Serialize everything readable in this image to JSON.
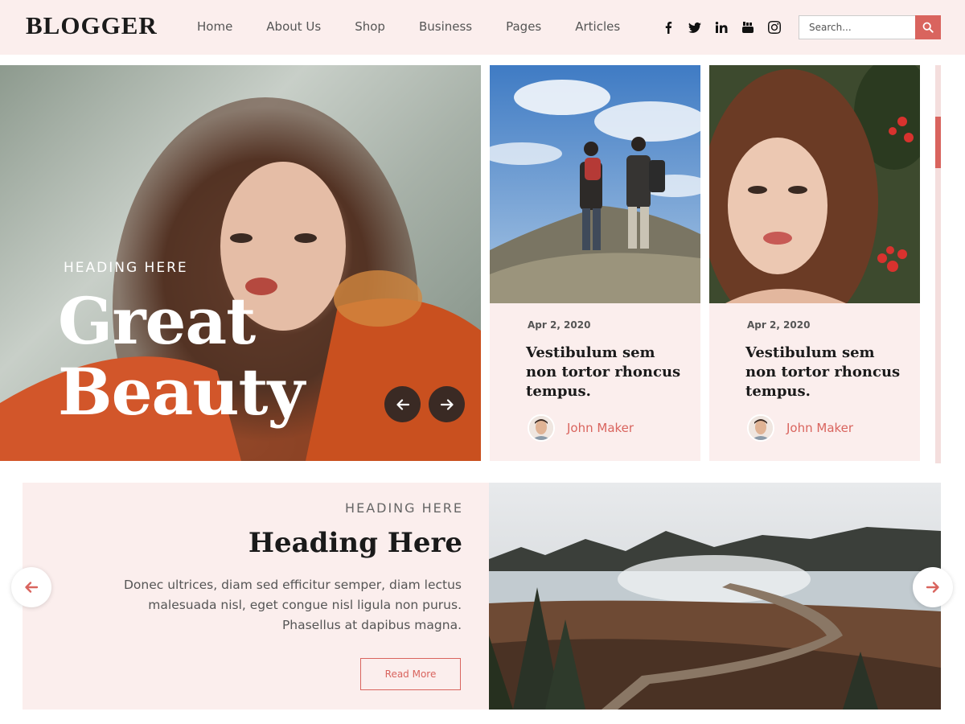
{
  "header": {
    "logo": "BLOGGER",
    "nav": [
      "Home",
      "About Us",
      "Shop",
      "Business",
      "Pages",
      "Articles"
    ],
    "social_icons": [
      "facebook-icon",
      "twitter-icon",
      "linkedin-icon",
      "youtube-icon",
      "instagram-icon"
    ],
    "search": {
      "placeholder": "Search..."
    }
  },
  "hero": {
    "subheading": "HEADING HERE",
    "title_line1": "Great",
    "title_line2": "Beauty"
  },
  "cards": [
    {
      "date": "Apr 2, 2020",
      "title": "Vestibulum sem non tortor rhoncus tempus.",
      "author": "John Maker"
    },
    {
      "date": "Apr 2, 2020",
      "title": "Vestibulum sem non tortor rhoncus tempus.",
      "author": "John Maker"
    }
  ],
  "feature": {
    "subheading": "HEADING HERE",
    "title": "Heading Here",
    "text": "Donec ultrices, diam sed efficitur semper, diam lectus malesuada nisl, eget congue nisl ligula non purus. Phasellus at dapibus magna.",
    "button": "Read More"
  },
  "colors": {
    "accent": "#d9645e",
    "panel": "#fbeeed",
    "dark_arrow": "#3a2a24"
  }
}
